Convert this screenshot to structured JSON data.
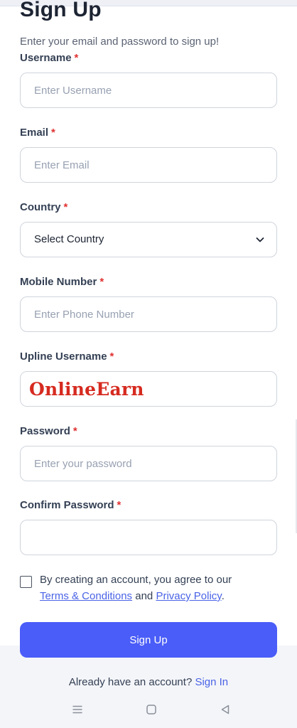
{
  "header": {
    "title": "Sign Up",
    "subtitle": "Enter your email and password to sign up!"
  },
  "form": {
    "required_mark": "*",
    "username": {
      "label": "Username",
      "placeholder": "Enter Username",
      "value": ""
    },
    "email": {
      "label": "Email",
      "placeholder": "Enter Email",
      "value": ""
    },
    "country": {
      "label": "Country",
      "selected": "Select Country"
    },
    "mobile": {
      "label": "Mobile Number",
      "placeholder": "Enter Phone Number",
      "value": ""
    },
    "upline": {
      "label": "Upline Username",
      "value": "",
      "overlay_text": "OnlineEarn"
    },
    "password": {
      "label": "Password",
      "placeholder": "Enter your password",
      "value": ""
    },
    "confirm_password": {
      "label": "Confirm Password",
      "placeholder": "",
      "value": ""
    }
  },
  "agreement": {
    "checked": false,
    "text_before": "By creating an account, you agree to our",
    "terms_link": "Terms & Conditions",
    "conjunction": " and ",
    "privacy_link": "Privacy Policy",
    "text_after": "."
  },
  "actions": {
    "signup_label": "Sign Up"
  },
  "footer": {
    "prompt": "Already have an account?",
    "signin_link": "Sign In"
  },
  "system_nav": {
    "icons": [
      "menu-icon",
      "home-icon",
      "back-icon"
    ]
  },
  "colors": {
    "accent": "#4a5df8",
    "link": "#4a63e6",
    "required": "#e03131",
    "overlay_text": "#d62a1f"
  }
}
